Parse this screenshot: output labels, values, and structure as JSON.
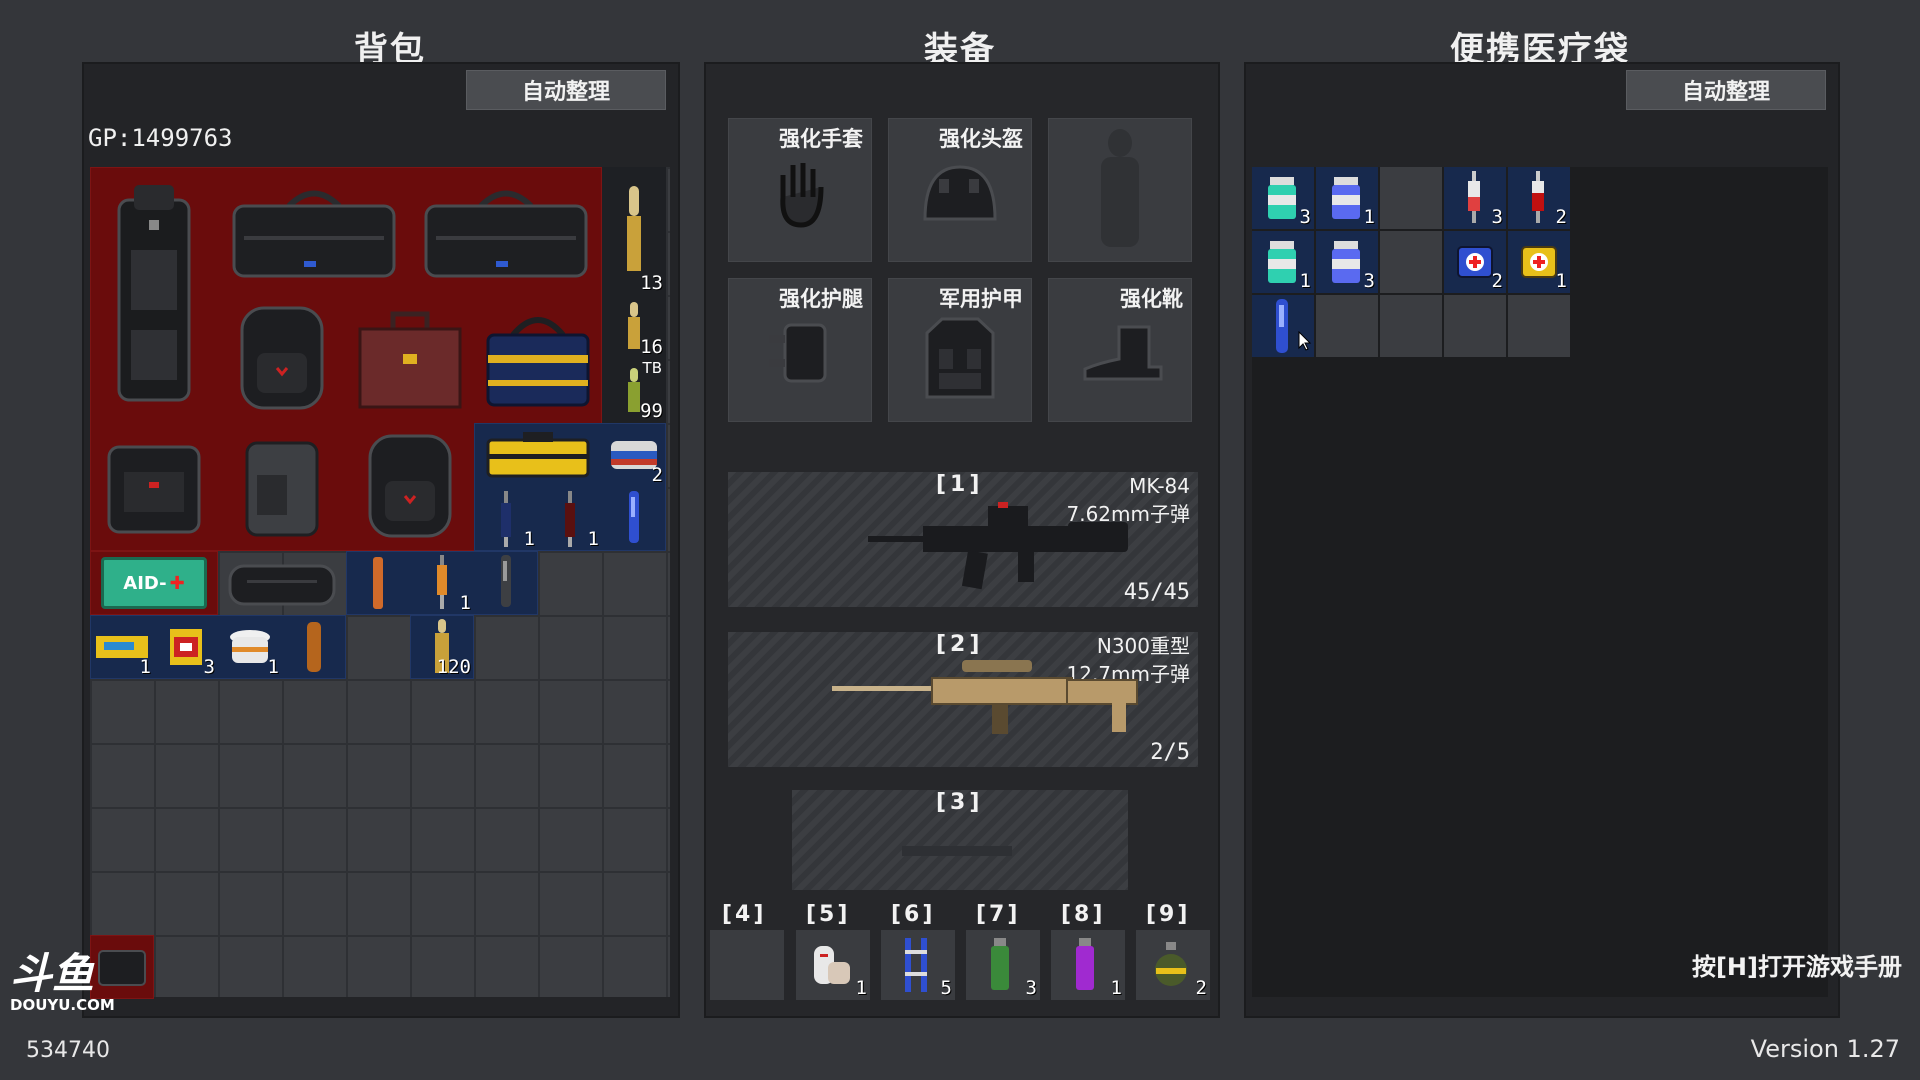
{
  "titles": {
    "backpack": "背包",
    "equipment": "装备",
    "med_bag": "便携医疗袋"
  },
  "backpack": {
    "sort_label": "自动整理",
    "gp_text": "GP:1499763"
  },
  "med_bag": {
    "sort_label": "自动整理"
  },
  "ammo_counts": [
    "13",
    "16",
    "99",
    "2",
    "1",
    "1",
    "1",
    "120"
  ],
  "ammo_tag": "TB",
  "consumable_counts": [
    "1",
    "3",
    "1"
  ],
  "medkit_label": "AID-",
  "equipment": {
    "slots": [
      "强化手套",
      "强化头盔",
      "",
      "强化护腿",
      "军用护甲",
      "强化靴"
    ]
  },
  "weapons": [
    {
      "slot": "[1]",
      "name": "MK-84",
      "ammo_type": "7.62mm子弹",
      "ammo": "45/45"
    },
    {
      "slot": "[2]",
      "name": "N300重型",
      "ammo_type": "12.7mm子弹",
      "ammo": "2/5"
    },
    {
      "slot": "[3]",
      "name": "",
      "ammo_type": "",
      "ammo": ""
    }
  ],
  "quick_slots": [
    {
      "slot": "[4]",
      "count": ""
    },
    {
      "slot": "[5]",
      "count": "1"
    },
    {
      "slot": "[6]",
      "count": "5"
    },
    {
      "slot": "[7]",
      "count": "3"
    },
    {
      "slot": "[8]",
      "count": "1"
    },
    {
      "slot": "[9]",
      "count": "2"
    }
  ],
  "med_items": [
    "3",
    "1",
    "3",
    "2",
    "1",
    "3",
    "2",
    "1"
  ],
  "hint": "按[H]打开游戏手册",
  "footer": {
    "id": "534740",
    "version": "Version 1.27"
  },
  "logo": {
    "text": "斗鱼",
    "sub": "DOUYU.COM"
  },
  "colors": {
    "red_slot": "#6a0c0c",
    "blue_slot": "#17294d",
    "panel": "#232427"
  }
}
